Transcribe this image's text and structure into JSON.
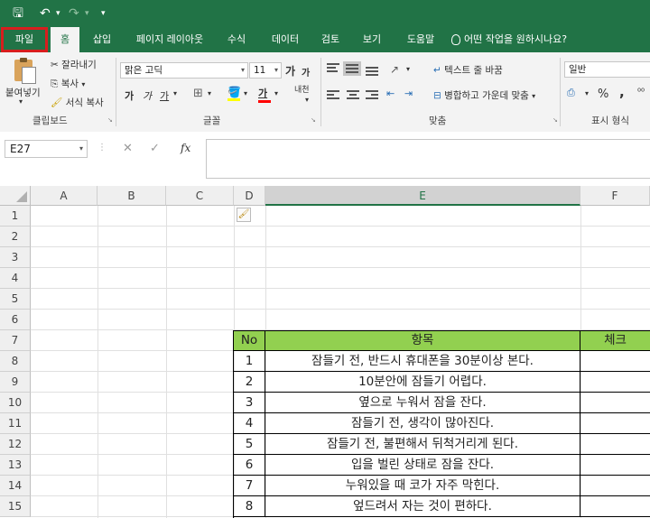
{
  "quick_access": {
    "save": "🖫",
    "undo": "↶",
    "undo_dd": "▾",
    "redo": "↷",
    "redo_dd": "▾",
    "customize": "▾"
  },
  "tabs": [
    "파일",
    "홈",
    "삽입",
    "페이지 레이아웃",
    "수식",
    "데이터",
    "검토",
    "보기",
    "도움말"
  ],
  "tell_me": "어떤 작업을 원하시나요?",
  "ribbon": {
    "clipboard": {
      "paste": "붙여넣기",
      "cut": "잘라내기",
      "copy": "복사",
      "copy_dd": "▾",
      "format_painter": "서식 복사",
      "group": "클립보드"
    },
    "font": {
      "name": "맑은 고딕",
      "size": "11",
      "grow": "가",
      "shrink": "가",
      "bold": "가",
      "italic": "가",
      "underline": "가",
      "phonetic": "내천",
      "group": "글꼴"
    },
    "align": {
      "wrap": "텍스트 줄 바꿈",
      "merge": "병합하고 가운데 맞춤",
      "group": "맞춤"
    },
    "number": {
      "format": "일반",
      "percent": "%",
      "comma": ",",
      "group": "표시 형식"
    }
  },
  "formula_bar": {
    "name_box": "E27",
    "cancel": "✕",
    "enter": "✓",
    "fx": "fx"
  },
  "columns": [
    "A",
    "B",
    "C",
    "D",
    "E",
    "F"
  ],
  "rows": [
    "1",
    "2",
    "3",
    "4",
    "5",
    "6",
    "7",
    "8",
    "9",
    "10",
    "11",
    "12",
    "13",
    "14",
    "15"
  ],
  "table": {
    "headers": [
      "No",
      "항목",
      "체크"
    ],
    "items": [
      {
        "no": "1",
        "text": "잠들기 전, 반드시 휴대폰을 30분이상 본다."
      },
      {
        "no": "2",
        "text": "10분안에 잠들기 어렵다."
      },
      {
        "no": "3",
        "text": "옆으로 누워서 잠을 잔다."
      },
      {
        "no": "4",
        "text": "잠들기 전, 생각이 많아진다."
      },
      {
        "no": "5",
        "text": "잠들기 전, 불편해서 뒤척거리게 된다."
      },
      {
        "no": "6",
        "text": "입을 벌린 상태로 잠을 잔다."
      },
      {
        "no": "7",
        "text": "누워있을 때 코가 자주 막힌다."
      },
      {
        "no": "8",
        "text": "엎드려서 자는 것이 편하다."
      }
    ]
  },
  "colors": {
    "brand": "#217346",
    "header_fill": "#92d050",
    "file_outline": "#d81e1e"
  }
}
